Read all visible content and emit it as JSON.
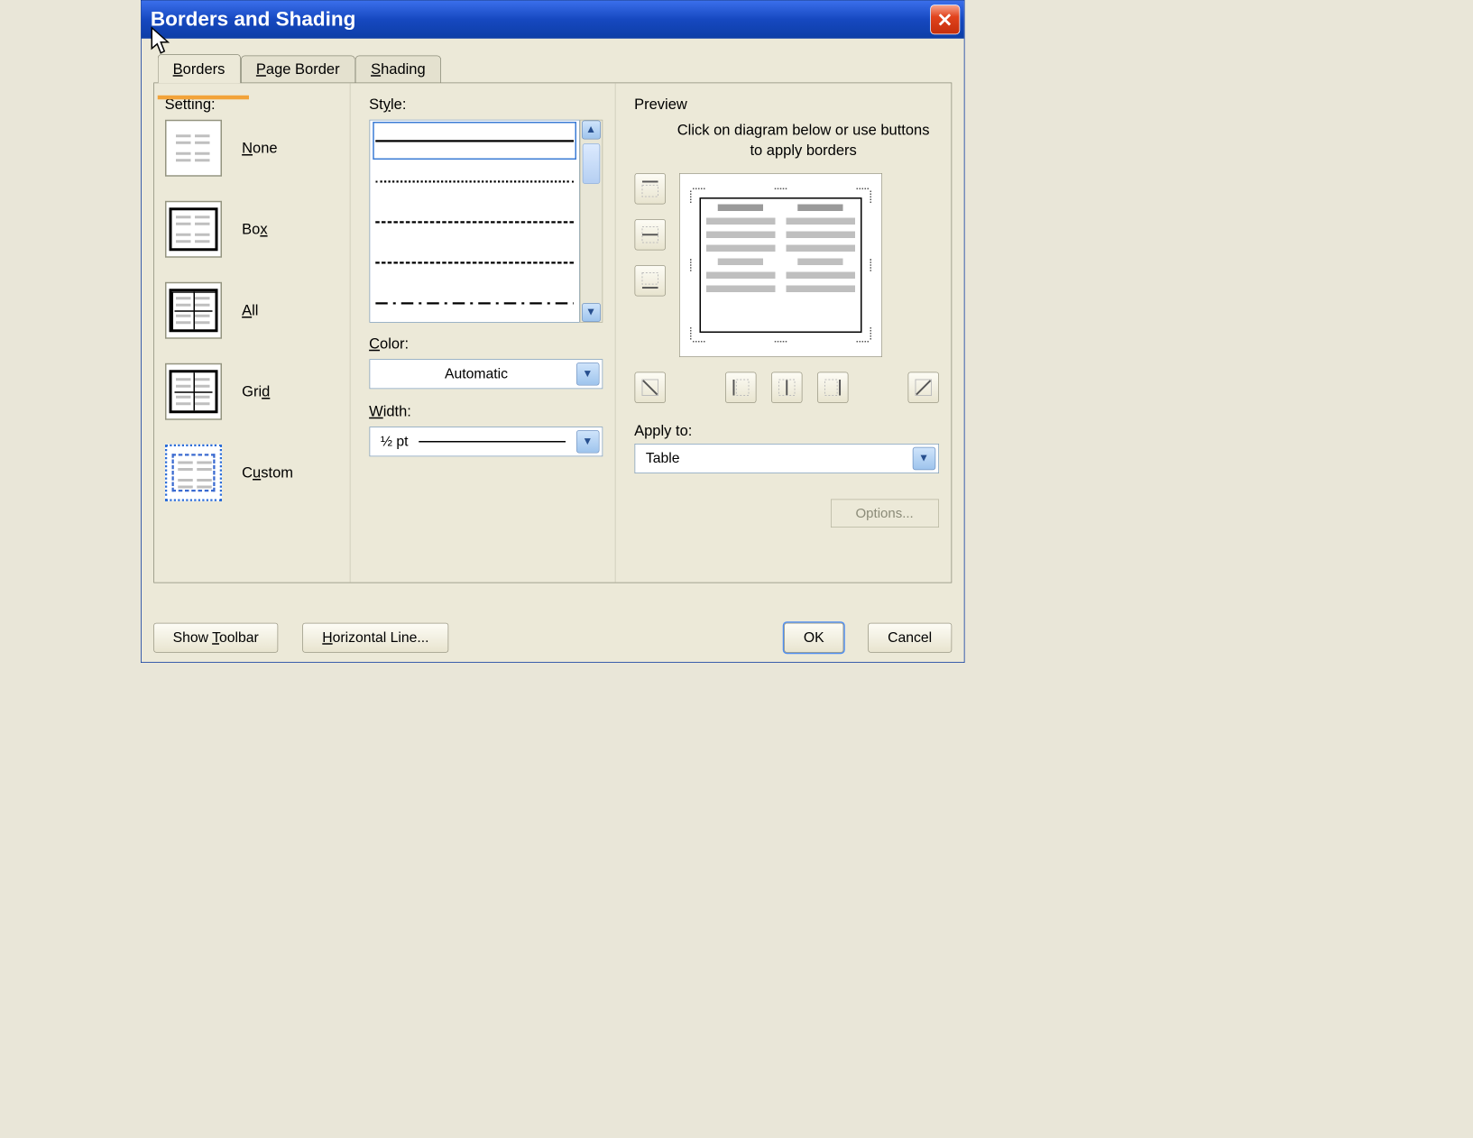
{
  "window": {
    "title": "Borders and Shading"
  },
  "tabs": {
    "borders": "Borders",
    "page_border": "Page Border",
    "shading": "Shading",
    "active": "borders"
  },
  "setting": {
    "label": "Setting:",
    "options": {
      "none": "None",
      "box": "Box",
      "all": "All",
      "grid": "Grid",
      "custom": "Custom"
    },
    "selected": "custom"
  },
  "style": {
    "label": "Style:",
    "items": [
      "solid",
      "dotted",
      "dashed-medium",
      "dashed-long",
      "dash-dot"
    ],
    "selected_index": 0
  },
  "color": {
    "label": "Color:",
    "value": "Automatic"
  },
  "width": {
    "label": "Width:",
    "value": "½ pt"
  },
  "preview": {
    "label": "Preview",
    "hint": "Click on diagram below or use buttons to apply borders",
    "side_buttons": [
      "border-top",
      "border-inside-horizontal",
      "border-bottom"
    ],
    "bottom_buttons_left": [
      "diagonal-down"
    ],
    "bottom_buttons_mid": [
      "border-left",
      "border-inside-vertical",
      "border-right"
    ],
    "bottom_buttons_right": [
      "diagonal-up"
    ]
  },
  "apply_to": {
    "label": "Apply to:",
    "value": "Table"
  },
  "buttons": {
    "options": "Options...",
    "show_toolbar": "Show Toolbar",
    "horizontal_line": "Horizontal Line...",
    "ok": "OK",
    "cancel": "Cancel"
  }
}
